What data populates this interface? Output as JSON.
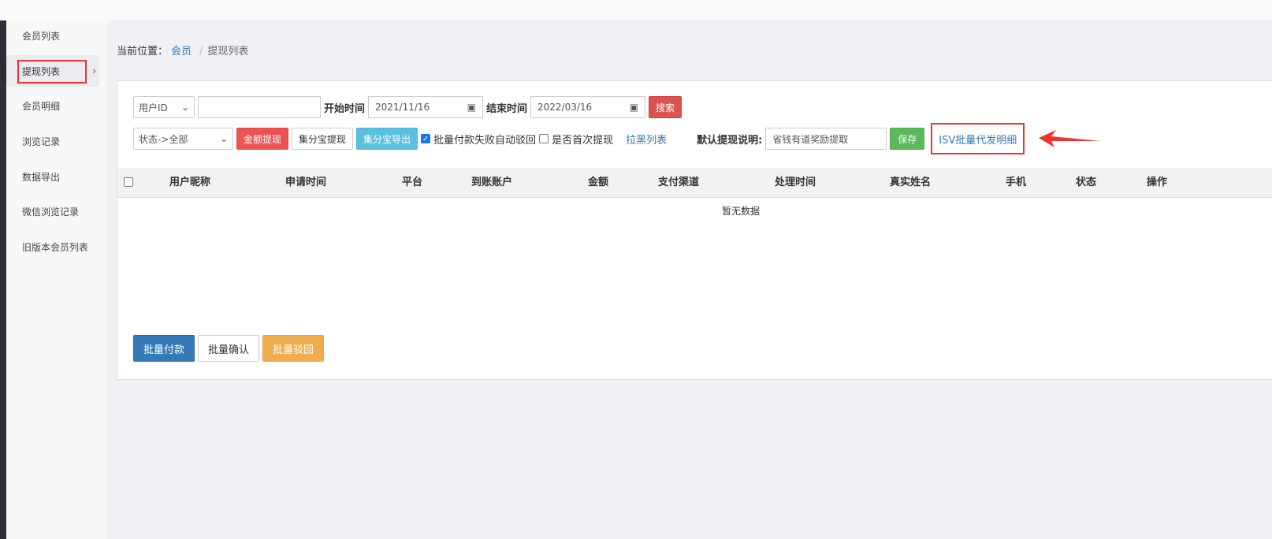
{
  "sidebar": {
    "items": [
      {
        "label": "会员列表"
      },
      {
        "label": "提现列表",
        "active": true
      },
      {
        "label": "会员明细"
      },
      {
        "label": "浏览记录"
      },
      {
        "label": "数据导出"
      },
      {
        "label": "微信浏览记录"
      },
      {
        "label": "旧版本会员列表"
      }
    ],
    "chevron": "›"
  },
  "breadcrumb": {
    "prefix": "当前位置：",
    "link": "会员",
    "separator": "/",
    "current": "提现列表"
  },
  "filters": {
    "user_select": "用户ID",
    "user_input_value": "",
    "start_label": "开始时间",
    "start_value": "2021/11/16",
    "end_label": "结束时间",
    "end_value": "2022/03/16",
    "search_label": "搜索",
    "status_select": "状态->全部",
    "amount_withdraw_label": "金额提现",
    "jfb_withdraw_label": "集分宝提现",
    "jfb_export_label": "集分宝导出",
    "auto_reject_label": "批量付款失败自动驳回",
    "auto_reject_checked": true,
    "first_withdraw_label": "是否首次提现",
    "first_withdraw_checked": false,
    "blacklist_label": "拉黑列表",
    "default_desc_label": "默认提现说明:",
    "default_desc_value": "省钱有道奖励提取",
    "save_label": "保存",
    "isv_label": "ISV批量代发明细"
  },
  "table": {
    "columns": [
      "用户昵称",
      "申请时间",
      "平台",
      "到账账户",
      "金额",
      "支付渠道",
      "处理时间",
      "真实姓名",
      "手机",
      "状态",
      "操作"
    ],
    "empty_text": "暂无数据"
  },
  "footer": {
    "batch_pay": "批量付款",
    "batch_confirm": "批量确认",
    "batch_reject": "批量驳回"
  },
  "colors": {
    "highlight": "#e33333",
    "primary": "#337ab7",
    "danger": "#d9534f",
    "success": "#5cb85c",
    "info": "#5bc0de",
    "warning": "#f0ad4e"
  }
}
